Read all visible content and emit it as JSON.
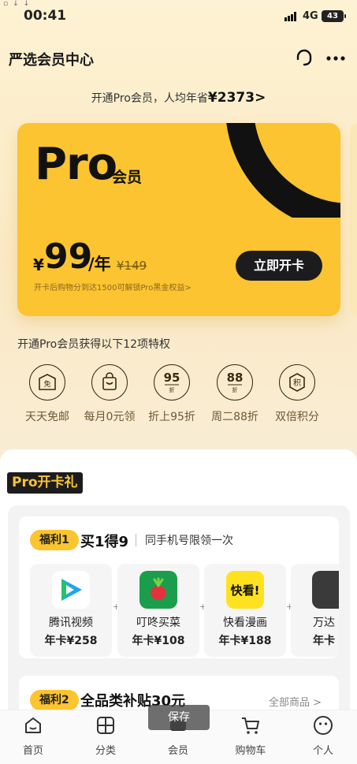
{
  "status_bar": {
    "time": "00:41",
    "network": "4G",
    "battery": "43"
  },
  "header": {
    "title": "严选会员中心"
  },
  "savings": {
    "prefix": "开通Pro会员，人均年省",
    "amount": "¥2373",
    "arrow": ">"
  },
  "card": {
    "pro": "Pro",
    "pro_suffix": "会员",
    "currency": "¥",
    "price": "99",
    "per": "/年",
    "original_price": "¥149",
    "note": "开卡后购物分到达1500可解锁Pro黑金权益>",
    "button": "立即开卡"
  },
  "privileges": {
    "title": "开通Pro会员获得以下12项特权",
    "items": [
      {
        "label": "天天免邮",
        "icon": "free-shipping-icon",
        "glyph": "免"
      },
      {
        "label": "每月0元领",
        "icon": "gift-bag-icon",
        "glyph": ""
      },
      {
        "label": "折上95折",
        "icon": "discount-95-icon",
        "glyph": "95",
        "sub": "折"
      },
      {
        "label": "周二88折",
        "icon": "discount-88-icon",
        "glyph": "88",
        "sub": "折"
      },
      {
        "label": "双倍积分",
        "icon": "points-icon",
        "glyph": "积"
      }
    ]
  },
  "gift_section": {
    "tag": "Pro开卡礼",
    "benefit1": {
      "badge": "福利1",
      "title": "买1得9",
      "subtitle": "同手机号限领一次",
      "items": [
        {
          "name": "腾讯视频",
          "price": "年卡¥258",
          "icon": "tencent-video-icon"
        },
        {
          "name": "叮咚买菜",
          "price": "年卡¥108",
          "icon": "dingdong-icon"
        },
        {
          "name": "快看漫画",
          "price": "年卡¥188",
          "icon": "kuaikan-icon",
          "logo_text": "快看!"
        },
        {
          "name": "万达",
          "price": "年卡",
          "icon": "wanda-icon"
        }
      ],
      "plus": "+"
    },
    "benefit2": {
      "badge": "福利2",
      "title": "全品类补贴30元",
      "link": "全部商品 >"
    }
  },
  "toast": "保存",
  "nav": [
    {
      "label": "首页",
      "icon": "home-icon"
    },
    {
      "label": "分类",
      "icon": "category-icon"
    },
    {
      "label": "会员",
      "icon": "member-icon"
    },
    {
      "label": "购物车",
      "icon": "cart-icon"
    },
    {
      "label": "个人",
      "icon": "profile-icon"
    }
  ],
  "colors": {
    "accent": "#FBC430",
    "dark": "#1C1C1E",
    "bg": "#FBE9C4"
  }
}
